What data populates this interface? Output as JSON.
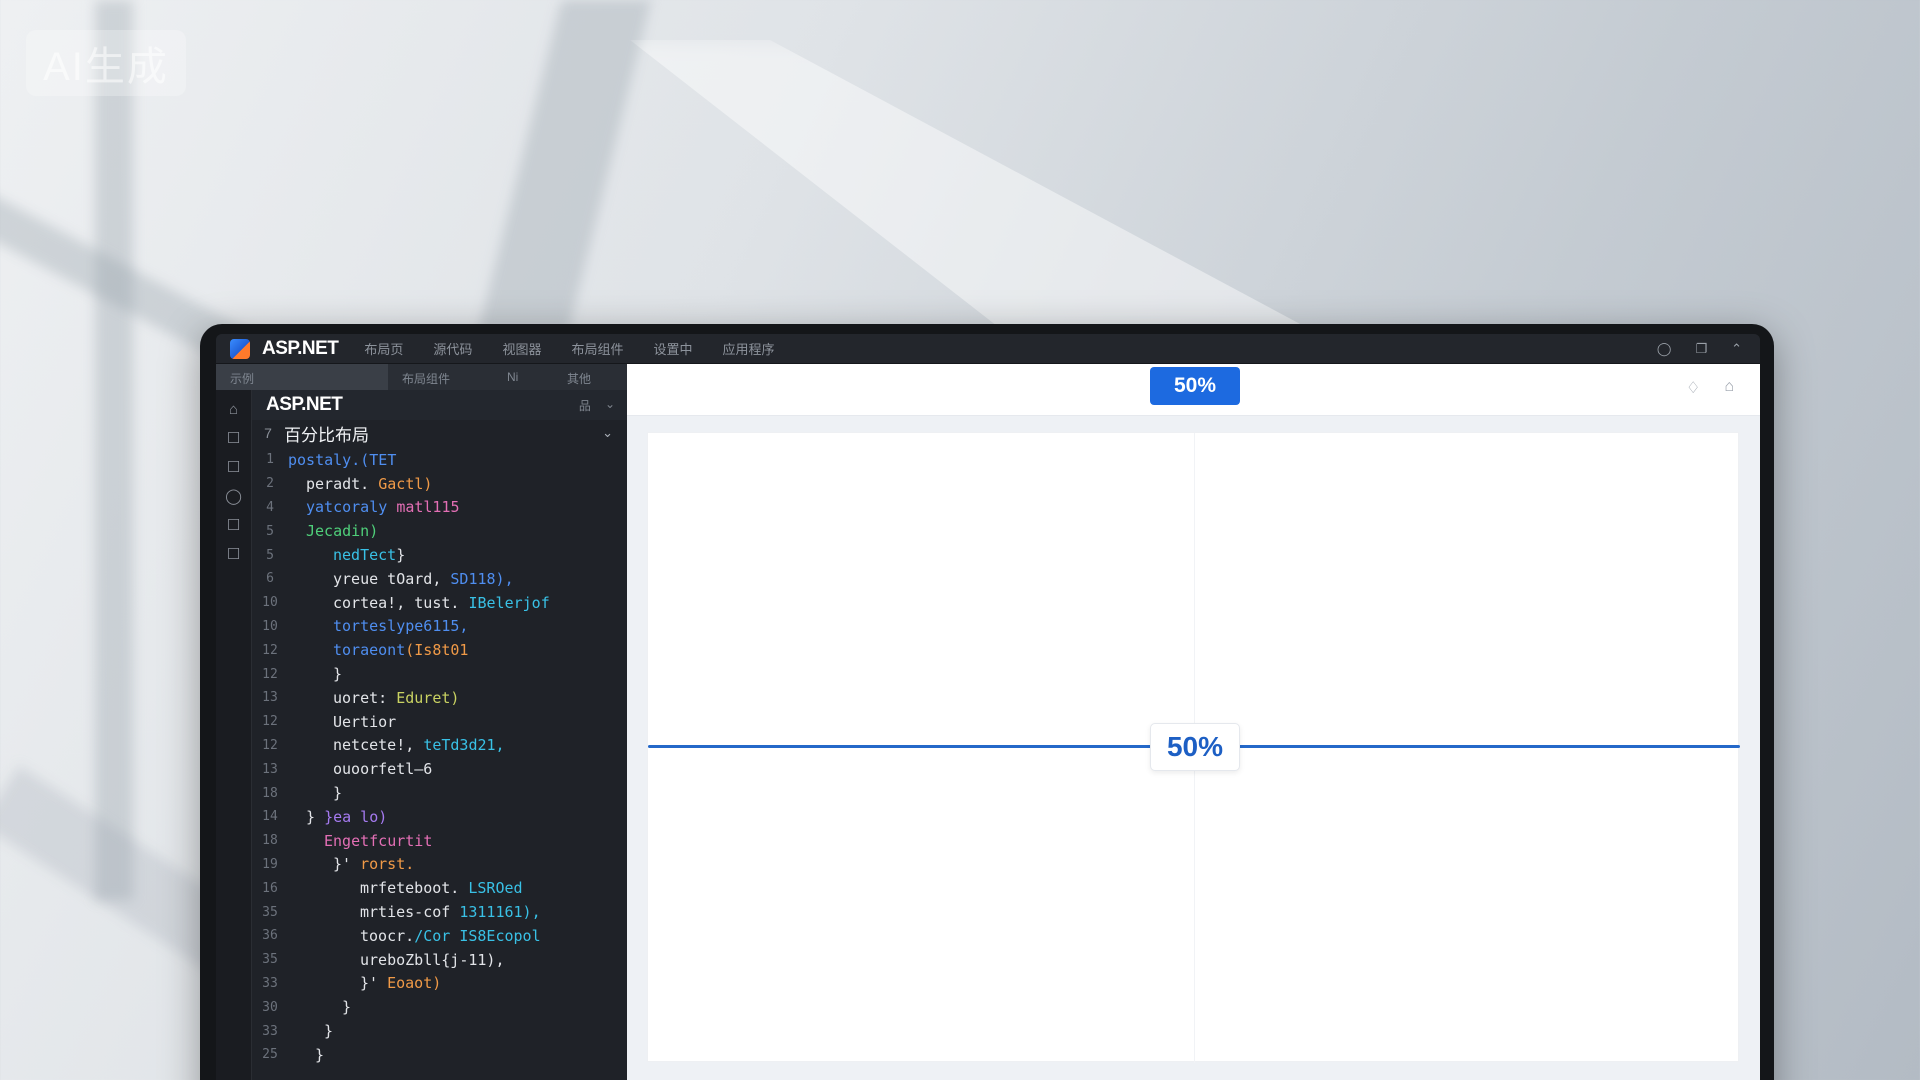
{
  "watermark": "AI生成",
  "app": {
    "title": "ASP.NET",
    "menu": [
      "布局页",
      "源代码",
      "视图器",
      "布局组件",
      "设置中",
      "应用程序"
    ],
    "window_controls": [
      "◯",
      "❐",
      "⌃"
    ]
  },
  "editor": {
    "tabs": [
      "示例",
      "布局组件",
      "Ni",
      "其他"
    ],
    "activity_icons": [
      "⌂",
      "☐",
      "☐",
      "◯",
      "☐",
      "☐"
    ],
    "project_title": "ASP.NET",
    "project_icons": [
      "品",
      "⌄"
    ],
    "file": {
      "number": "7",
      "name": "百分比布局",
      "chevron": "⌄"
    },
    "lines": [
      {
        "n": "1",
        "indent": 0,
        "parts": [
          {
            "c": "c-blue",
            "t": "postaly.(TET"
          }
        ]
      },
      {
        "n": "2",
        "indent": 2,
        "parts": [
          {
            "c": "c-white",
            "t": "peradt. "
          },
          {
            "c": "c-orange",
            "t": "Gactl)"
          }
        ]
      },
      {
        "n": "4",
        "indent": 2,
        "parts": [
          {
            "c": "c-blue",
            "t": "yatcoraly "
          },
          {
            "c": "c-pink",
            "t": "matl115"
          }
        ]
      },
      {
        "n": "5",
        "indent": 2,
        "parts": [
          {
            "c": "c-green",
            "t": "Jecadin)"
          }
        ]
      },
      {
        "n": "5",
        "indent": 5,
        "parts": [
          {
            "c": "c-cyan",
            "t": "nedTect"
          },
          {
            "c": "c-white",
            "t": "}"
          }
        ]
      },
      {
        "n": "6",
        "indent": 5,
        "parts": [
          {
            "c": "c-white",
            "t": "yreue tOard, "
          },
          {
            "c": "c-blue",
            "t": "SD118),"
          }
        ]
      },
      {
        "n": "10",
        "indent": 5,
        "parts": [
          {
            "c": "c-white",
            "t": "cortea!, "
          },
          {
            "c": "c-white",
            "t": "tust. "
          },
          {
            "c": "c-cyan",
            "t": "IBelerjof"
          }
        ]
      },
      {
        "n": "10",
        "indent": 5,
        "parts": [
          {
            "c": "c-blue",
            "t": "torteslype6115,"
          }
        ]
      },
      {
        "n": "12",
        "indent": 5,
        "parts": [
          {
            "c": "c-blue",
            "t": "toraeont"
          },
          {
            "c": "c-orange",
            "t": "(Is8t01"
          }
        ]
      },
      {
        "n": "12",
        "indent": 5,
        "parts": [
          {
            "c": "c-white",
            "t": "}"
          }
        ]
      },
      {
        "n": "13",
        "indent": 5,
        "parts": [
          {
            "c": "c-white",
            "t": "uoret: "
          },
          {
            "c": "c-yellow",
            "t": "Eduret)"
          }
        ]
      },
      {
        "n": "12",
        "indent": 5,
        "parts": [
          {
            "c": "c-white",
            "t": "Uertior"
          }
        ]
      },
      {
        "n": "12",
        "indent": 5,
        "parts": [
          {
            "c": "c-white",
            "t": " netcete!, "
          },
          {
            "c": "c-cyan",
            "t": "teTd3d21,"
          }
        ]
      },
      {
        "n": "13",
        "indent": 5,
        "parts": [
          {
            "c": "c-white",
            "t": "ouoorfetl—6"
          }
        ]
      },
      {
        "n": "18",
        "indent": 5,
        "parts": [
          {
            "c": "c-white",
            "t": "}"
          }
        ]
      },
      {
        "n": "14",
        "indent": 2,
        "parts": [
          {
            "c": "c-white",
            "t": "}  "
          },
          {
            "c": "c-purple",
            "t": "}ea lo)"
          }
        ]
      },
      {
        "n": "18",
        "indent": 4,
        "parts": [
          {
            "c": "c-pink",
            "t": "Engetfcurtit"
          }
        ]
      },
      {
        "n": "19",
        "indent": 5,
        "parts": [
          {
            "c": "c-white",
            "t": "}' "
          },
          {
            "c": "c-orange",
            "t": "rorst."
          }
        ]
      },
      {
        "n": "16",
        "indent": 8,
        "parts": [
          {
            "c": "c-white",
            "t": "mrfeteboot. "
          },
          {
            "c": "c-cyan",
            "t": "LSROed"
          }
        ]
      },
      {
        "n": "35",
        "indent": 8,
        "parts": [
          {
            "c": "c-white",
            "t": "mrties-cof "
          },
          {
            "c": "c-cyan",
            "t": "1311161),"
          }
        ]
      },
      {
        "n": "36",
        "indent": 8,
        "parts": [
          {
            "c": "c-white",
            "t": "toocr."
          },
          {
            "c": "c-cyan",
            "t": "/Cor IS8Ecopol"
          }
        ]
      },
      {
        "n": "35",
        "indent": 8,
        "parts": [
          {
            "c": "c-white",
            "t": "ureboZbll{j-11),"
          }
        ]
      },
      {
        "n": "33",
        "indent": 8,
        "parts": [
          {
            "c": "c-white",
            "t": "}' "
          },
          {
            "c": "c-orange",
            "t": "Eoaot)"
          }
        ]
      },
      {
        "n": "30",
        "indent": 6,
        "parts": [
          {
            "c": "c-white",
            "t": "}"
          }
        ]
      },
      {
        "n": "33",
        "indent": 4,
        "parts": [
          {
            "c": "c-white",
            "t": "}"
          }
        ]
      },
      {
        "n": "25",
        "indent": 3,
        "parts": [
          {
            "c": "c-white",
            "t": "}"
          }
        ]
      }
    ]
  },
  "preview": {
    "badge": "50%",
    "center_label": "50%",
    "top_icons": [
      "♢",
      "⌂"
    ]
  }
}
